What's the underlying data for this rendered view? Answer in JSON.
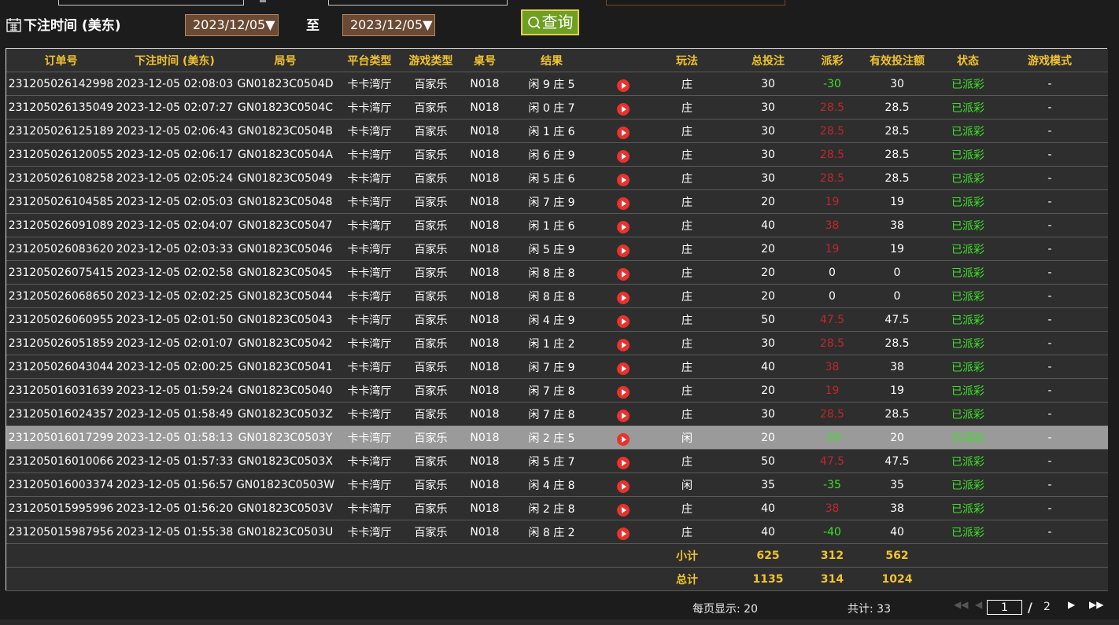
{
  "filter": {
    "label": "下注时间 (美东)",
    "start_date": "2023/12/05▼",
    "to_label": "至",
    "end_date": "2023/12/05▼",
    "query_label": "查询"
  },
  "table": {
    "headers": [
      "订单号",
      "下注时间 (美东)",
      "局号",
      "平台类型",
      "游戏类型",
      "桌号",
      "结果",
      "",
      "玩法",
      "总投注",
      "派彩",
      "有效投注额",
      "状态",
      "游戏模式"
    ],
    "rows": [
      [
        "231205026142998",
        "2023-12-05 02:08:03",
        "GN01823C0504D",
        "卡卡湾厅",
        "百家乐",
        "N018",
        "闲 9 庄 5",
        "庄",
        "30",
        "-30",
        "30",
        "已派彩",
        "-"
      ],
      [
        "231205026135049",
        "2023-12-05 02:07:27",
        "GN01823C0504C",
        "卡卡湾厅",
        "百家乐",
        "N018",
        "闲 0 庄 7",
        "庄",
        "30",
        "28.5",
        "28.5",
        "已派彩",
        "-"
      ],
      [
        "231205026125189",
        "2023-12-05 02:06:43",
        "GN01823C0504B",
        "卡卡湾厅",
        "百家乐",
        "N018",
        "闲 1 庄 6",
        "庄",
        "30",
        "28.5",
        "28.5",
        "已派彩",
        "-"
      ],
      [
        "231205026120055",
        "2023-12-05 02:06:17",
        "GN01823C0504A",
        "卡卡湾厅",
        "百家乐",
        "N018",
        "闲 6 庄 9",
        "庄",
        "30",
        "28.5",
        "28.5",
        "已派彩",
        "-"
      ],
      [
        "231205026108258",
        "2023-12-05 02:05:24",
        "GN01823C05049",
        "卡卡湾厅",
        "百家乐",
        "N018",
        "闲 5 庄 6",
        "庄",
        "30",
        "28.5",
        "28.5",
        "已派彩",
        "-"
      ],
      [
        "231205026104585",
        "2023-12-05 02:05:03",
        "GN01823C05048",
        "卡卡湾厅",
        "百家乐",
        "N018",
        "闲 7 庄 9",
        "庄",
        "20",
        "19",
        "19",
        "已派彩",
        "-"
      ],
      [
        "231205026091089",
        "2023-12-05 02:04:07",
        "GN01823C05047",
        "卡卡湾厅",
        "百家乐",
        "N018",
        "闲 1 庄 6",
        "庄",
        "40",
        "38",
        "38",
        "已派彩",
        "-"
      ],
      [
        "231205026083620",
        "2023-12-05 02:03:33",
        "GN01823C05046",
        "卡卡湾厅",
        "百家乐",
        "N018",
        "闲 5 庄 9",
        "庄",
        "20",
        "19",
        "19",
        "已派彩",
        "-"
      ],
      [
        "231205026075415",
        "2023-12-05 02:02:58",
        "GN01823C05045",
        "卡卡湾厅",
        "百家乐",
        "N018",
        "闲 8 庄 8",
        "庄",
        "20",
        "0",
        "0",
        "已派彩",
        "-"
      ],
      [
        "231205026068650",
        "2023-12-05 02:02:25",
        "GN01823C05044",
        "卡卡湾厅",
        "百家乐",
        "N018",
        "闲 8 庄 8",
        "庄",
        "20",
        "0",
        "0",
        "已派彩",
        "-"
      ],
      [
        "231205026060955",
        "2023-12-05 02:01:50",
        "GN01823C05043",
        "卡卡湾厅",
        "百家乐",
        "N018",
        "闲 4 庄 9",
        "庄",
        "50",
        "47.5",
        "47.5",
        "已派彩",
        "-"
      ],
      [
        "231205026051859",
        "2023-12-05 02:01:07",
        "GN01823C05042",
        "卡卡湾厅",
        "百家乐",
        "N018",
        "闲 1 庄 2",
        "庄",
        "30",
        "28.5",
        "28.5",
        "已派彩",
        "-"
      ],
      [
        "231205026043044",
        "2023-12-05 02:00:25",
        "GN01823C05041",
        "卡卡湾厅",
        "百家乐",
        "N018",
        "闲 7 庄 9",
        "庄",
        "40",
        "38",
        "38",
        "已派彩",
        "-"
      ],
      [
        "231205016031639",
        "2023-12-05 01:59:24",
        "GN01823C05040",
        "卡卡湾厅",
        "百家乐",
        "N018",
        "闲 7 庄 8",
        "庄",
        "20",
        "19",
        "19",
        "已派彩",
        "-"
      ],
      [
        "231205016024357",
        "2023-12-05 01:58:49",
        "GN01823C0503Z",
        "卡卡湾厅",
        "百家乐",
        "N018",
        "闲 7 庄 8",
        "庄",
        "30",
        "28.5",
        "28.5",
        "已派彩",
        "-"
      ],
      [
        "231205016017299",
        "2023-12-05 01:58:13",
        "GN01823C0503Y",
        "卡卡湾厅",
        "百家乐",
        "N018",
        "闲 2 庄 5",
        "闲",
        "20",
        "-20",
        "20",
        "已派彩",
        "-"
      ],
      [
        "231205016010066",
        "2023-12-05 01:57:33",
        "GN01823C0503X",
        "卡卡湾厅",
        "百家乐",
        "N018",
        "闲 5 庄 7",
        "庄",
        "50",
        "47.5",
        "47.5",
        "已派彩",
        "-"
      ],
      [
        "231205016003374",
        "2023-12-05 01:56:57",
        "GN01823C0503W",
        "卡卡湾厅",
        "百家乐",
        "N018",
        "闲 4 庄 8",
        "闲",
        "35",
        "-35",
        "35",
        "已派彩",
        "-"
      ],
      [
        "231205015995996",
        "2023-12-05 01:56:20",
        "GN01823C0503V",
        "卡卡湾厅",
        "百家乐",
        "N018",
        "闲 2 庄 8",
        "庄",
        "40",
        "38",
        "38",
        "已派彩",
        "-"
      ],
      [
        "231205015987956",
        "2023-12-05 01:55:38",
        "GN01823C0503U",
        "卡卡湾厅",
        "百家乐",
        "N018",
        "闲 8 庄 2",
        "庄",
        "40",
        "-40",
        "40",
        "已派彩",
        "-"
      ]
    ],
    "highlighted_row": 15,
    "subtotal": {
      "label": "小计",
      "total_bet": "625",
      "payout": "312",
      "valid_bet": "562"
    },
    "grand_total": {
      "label": "总计",
      "total_bet": "1135",
      "payout": "314",
      "valid_bet": "1024"
    }
  },
  "pager": {
    "per_page": "每页显示: 20",
    "total": "共计: 33",
    "first": "◀◀",
    "prev": "◀",
    "current_page": "1",
    "slash": "/",
    "total_pages": "2",
    "next": "▶",
    "last": "▶▶"
  },
  "colors": {
    "header_text": "#f0c330",
    "positive_payout": "#c0272d",
    "negative_payout": "#3fe02a",
    "status": "#3fe02a",
    "play_icon": "#e8322d"
  }
}
